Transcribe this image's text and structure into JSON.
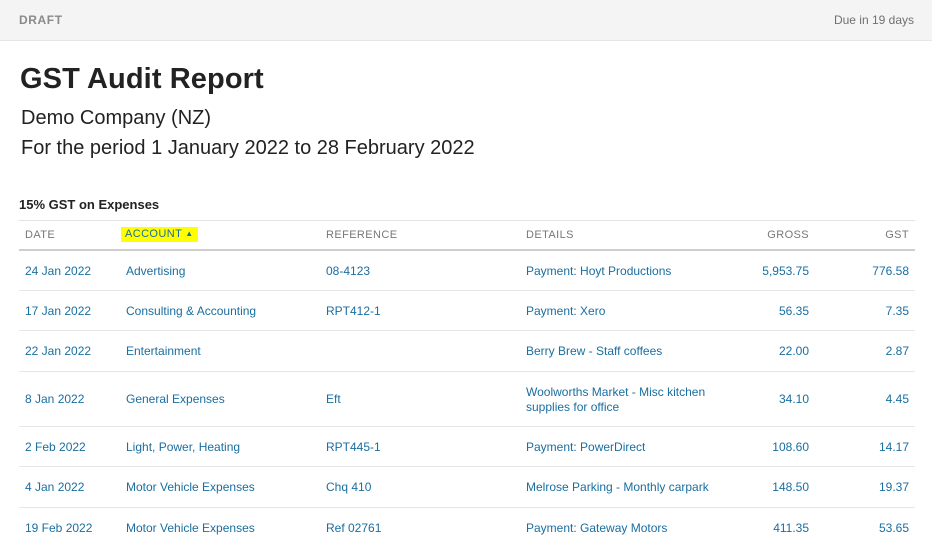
{
  "header": {
    "status": "DRAFT",
    "due": "Due in 19 days"
  },
  "report": {
    "title": "GST Audit Report",
    "company": "Demo Company (NZ)",
    "period": "For the period 1 January 2022 to 28 February 2022"
  },
  "section": {
    "title": "15% GST on Expenses",
    "columns": {
      "date": "DATE",
      "account": "ACCOUNT",
      "reference": "REFERENCE",
      "details": "DETAILS",
      "gross": "GROSS",
      "gst": "GST"
    },
    "sort_indicator": "▲",
    "rows": [
      {
        "date": "24 Jan 2022",
        "account": "Advertising",
        "reference": "08-4123",
        "details": "Payment: Hoyt Productions",
        "gross": "5,953.75",
        "gst": "776.58"
      },
      {
        "date": "17 Jan 2022",
        "account": "Consulting & Accounting",
        "reference": "RPT412-1",
        "details": "Payment: Xero",
        "gross": "56.35",
        "gst": "7.35"
      },
      {
        "date": "22 Jan 2022",
        "account": "Entertainment",
        "reference": "",
        "details": "Berry Brew - Staff coffees",
        "gross": "22.00",
        "gst": "2.87"
      },
      {
        "date": "8 Jan 2022",
        "account": "General Expenses",
        "reference": "Eft",
        "details": "Woolworths Market - Misc kitchen supplies for office",
        "gross": "34.10",
        "gst": "4.45"
      },
      {
        "date": "2 Feb 2022",
        "account": "Light, Power, Heating",
        "reference": "RPT445-1",
        "details": "Payment: PowerDirect",
        "gross": "108.60",
        "gst": "14.17"
      },
      {
        "date": "4 Jan 2022",
        "account": "Motor Vehicle Expenses",
        "reference": "Chq 410",
        "details": "Melrose Parking - Monthly carpark",
        "gross": "148.50",
        "gst": "19.37"
      },
      {
        "date": "19 Feb 2022",
        "account": "Motor Vehicle Expenses",
        "reference": "Ref 02761",
        "details": "Payment: Gateway Motors",
        "gross": "411.35",
        "gst": "53.65"
      }
    ]
  }
}
